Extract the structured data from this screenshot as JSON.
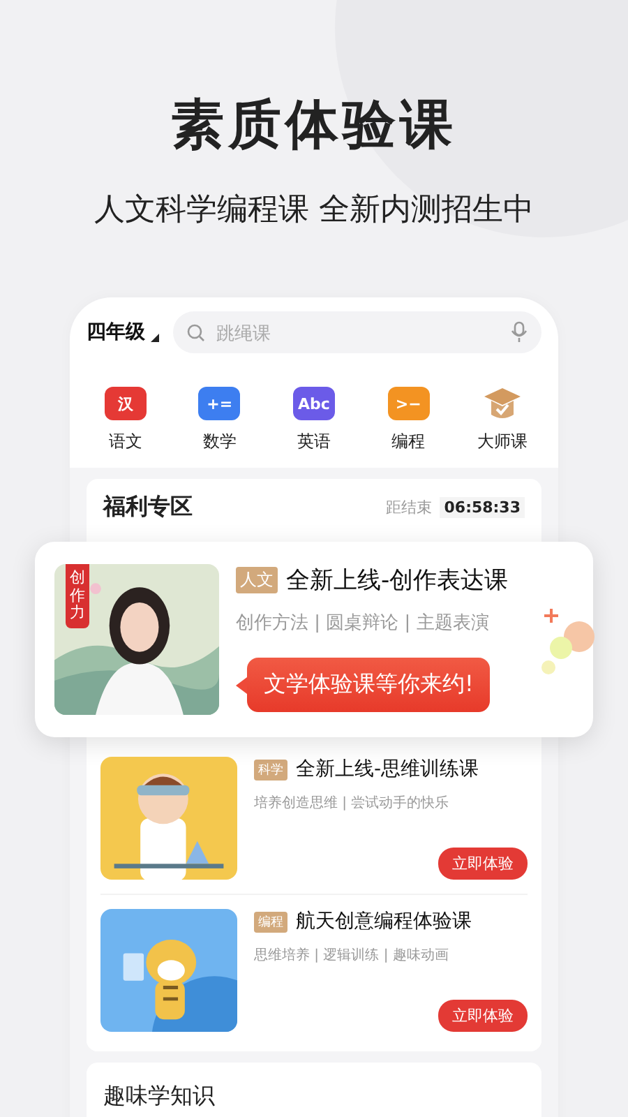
{
  "headline": "素质体验课",
  "subheadline": "人文科学编程课 全新内测招生中",
  "grade": "四年级",
  "search": {
    "placeholder": "跳绳课"
  },
  "categories": [
    {
      "label": "语文",
      "kind": "chinese",
      "glyph": "汉"
    },
    {
      "label": "数学",
      "kind": "math",
      "glyph": "+="
    },
    {
      "label": "英语",
      "kind": "english",
      "glyph": "Abc"
    },
    {
      "label": "编程",
      "kind": "code",
      "glyph": ">−"
    },
    {
      "label": "大师课",
      "kind": "master"
    }
  ],
  "welfare": {
    "title": "福利专区",
    "countdown_label": "距结束",
    "countdown": "06:58:33"
  },
  "featured": {
    "picture_tag": "创作力",
    "tag": "人文",
    "title": "全新上线-创作表达课",
    "features": "创作方法 | 圆桌辩论 | 主题表演",
    "callout": "文学体验课等你来约!"
  },
  "courses": [
    {
      "tag": "科学",
      "title": "全新上线-思维训练课",
      "features": "培养创造思维 | 尝试动手的快乐",
      "button": "立即体验"
    },
    {
      "tag": "编程",
      "title": "航天创意编程体验课",
      "features": "思维培养 | 逻辑训练 | 趣味动画",
      "button": "立即体验"
    }
  ],
  "next_section": {
    "title": "趣味学知识"
  }
}
